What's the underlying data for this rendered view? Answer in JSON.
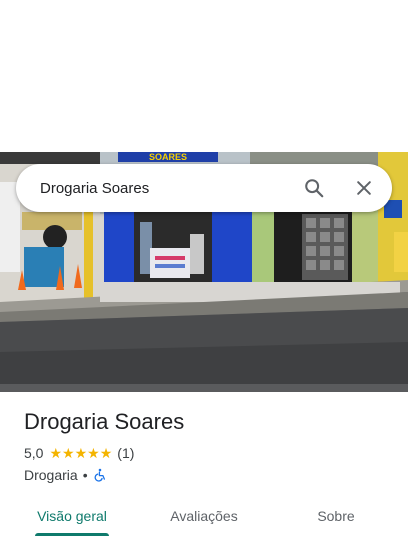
{
  "search": {
    "query": "Drogaria Soares"
  },
  "photo": {
    "sign_text": "SOARES"
  },
  "place": {
    "name": "Drogaria Soares",
    "rating": "5,0",
    "stars": [
      "★",
      "★",
      "★",
      "★",
      "★"
    ],
    "review_count": "(1)",
    "category": "Drogaria",
    "separator": "•"
  },
  "tabs": [
    {
      "label": "Visão geral",
      "active": true
    },
    {
      "label": "Avaliações",
      "active": false
    },
    {
      "label": "Sobre",
      "active": false
    }
  ],
  "colors": {
    "accent": "#0f7a6c",
    "star": "#f4b400",
    "accessibility": "#1a73e8"
  },
  "icons": {
    "search": "search-icon",
    "close": "close-icon",
    "accessibility": "wheelchair-icon"
  }
}
